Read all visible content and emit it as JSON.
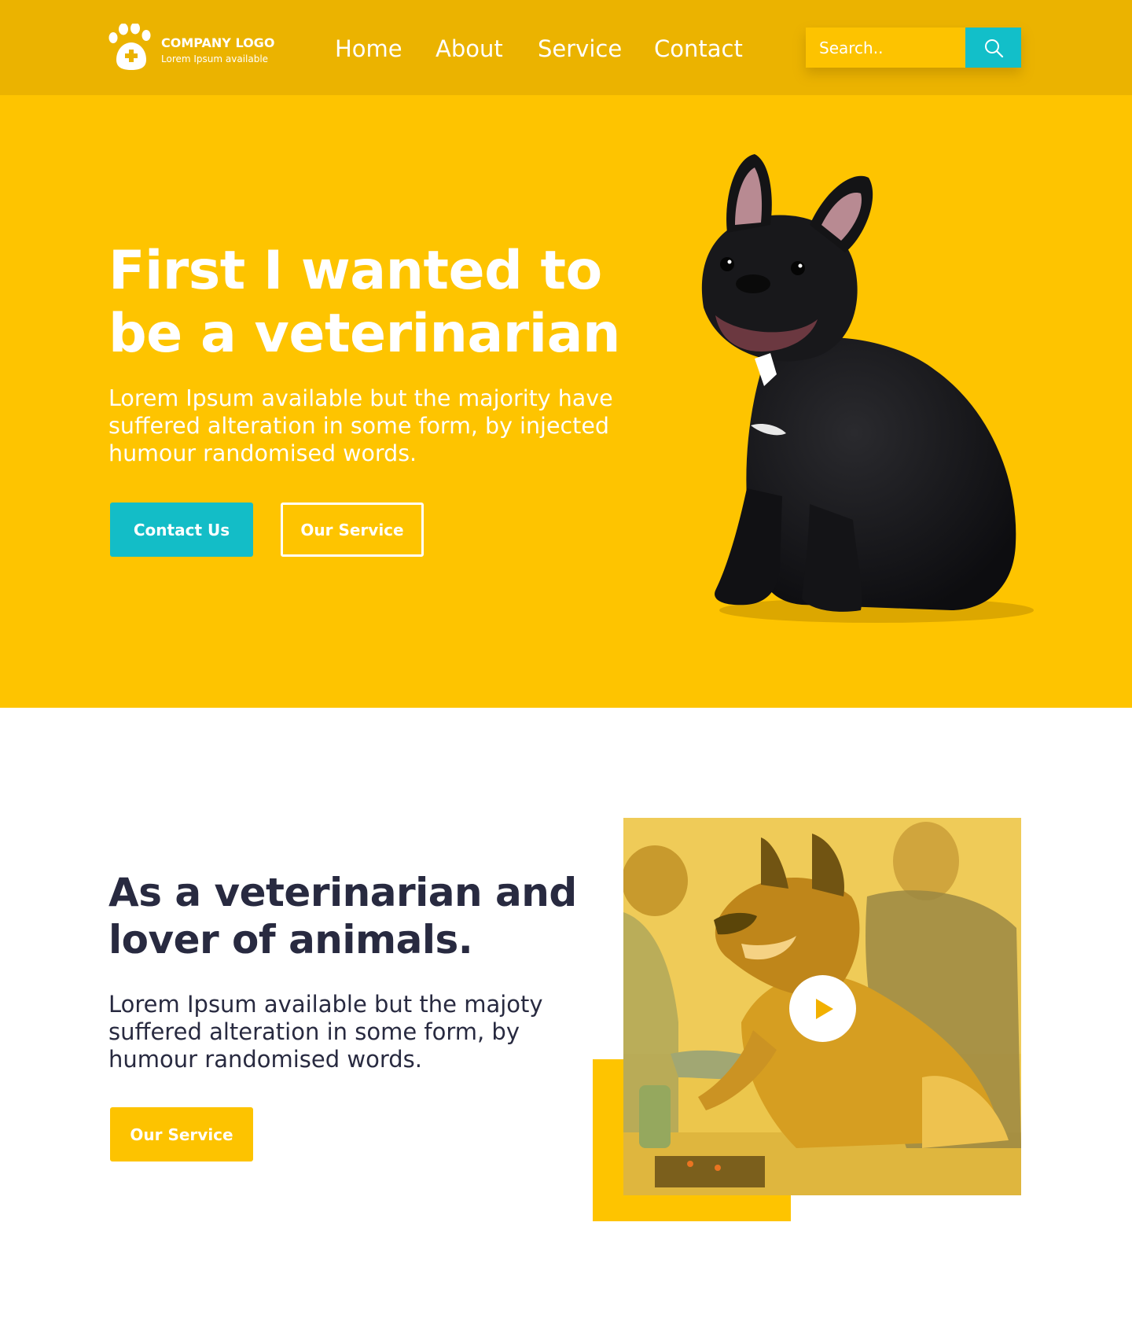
{
  "colors": {
    "header_bg": "#EBB300",
    "hero_bg": "#FEC400",
    "accent_teal": "#12BFC9",
    "dark_text": "#282A40",
    "white": "#FFFFFF"
  },
  "header": {
    "logo": {
      "icon": "paw-plus-icon",
      "title": "COMPANY LOGO",
      "subtitle": "Lorem Ipsum available"
    },
    "nav": [
      "Home",
      "About",
      "Service",
      "Contact"
    ],
    "search": {
      "placeholder": "Search..",
      "icon": "search-icon"
    }
  },
  "hero": {
    "title": "First I wanted to be a veterinarian",
    "text": "Lorem Ipsum available but the majority have suffered alteration in some form, by injected humour randomised words.",
    "primary_button": "Contact Us",
    "secondary_button": "Our Service",
    "image": "french-bulldog-photo"
  },
  "about": {
    "title": "As a veterinarian and lover of animals.",
    "text": "Lorem Ipsum available but the majoty suffered alteration in some form, by humour randomised words.",
    "button": "Our Service",
    "video": {
      "image": "vet-examining-german-shepherd-photo",
      "play_icon": "play-icon"
    }
  }
}
